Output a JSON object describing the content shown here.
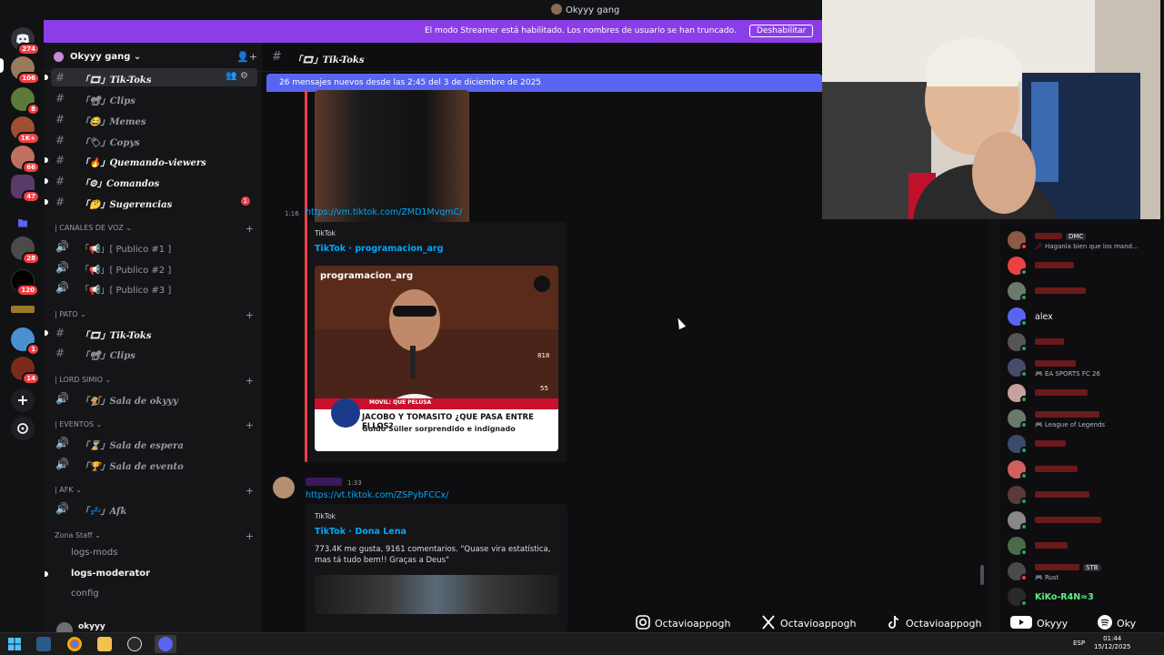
{
  "window": {
    "title": "Okyyy gang"
  },
  "banner": {
    "text": "El modo Streamer está habilitado. Los nombres de usuario se han truncado.",
    "button": "Deshabilitar"
  },
  "rail": {
    "badges": [
      "274",
      "106",
      "8",
      "1K+",
      "66",
      "47",
      "28",
      "120",
      "1",
      "14"
    ]
  },
  "guild": {
    "name": "Okyyy gang"
  },
  "channels": {
    "tiktoks": "「🎞」Tik-Toks",
    "clips": "「📽」Clips",
    "memes": "「😂」Memes",
    "copys": "「🏷」Copys",
    "quemando": "「🔥」Quemando-viewers",
    "comandos": "「⚙」Comandos",
    "sugerencias": "「🤔」Sugerencias",
    "sugerencias_badge": "1",
    "cat_voz": "| CANALES DE VOZ",
    "publico1": "「📢」[ Publico #1 ]",
    "publico2": "「📢」[ Publico #2 ]",
    "publico3": "「📢」[ Publico #3 ]",
    "cat_pato": "| PATO",
    "pato_tiktoks": "「🎞」Tik-Toks",
    "pato_clips": "「📽」Clips",
    "cat_lord": "| LORD SIMIO",
    "sala_okyyy": "「🐒」Sala de okyyy",
    "cat_eventos": "| EVENTOS",
    "sala_espera": "「⏳」Sala de espera",
    "sala_evento": "「🏆」Sala de evento",
    "cat_afk": "| AFK",
    "afk": "「💤」Afk",
    "cat_staff": "Zona Staff",
    "logs_mods": "logs-mods",
    "logs_moderator": "logs-moderator",
    "config": "config"
  },
  "user": {
    "name": "okyyy"
  },
  "chat": {
    "header": "「🎞」Tik-Toks",
    "newbar": "26 mensajes nuevos desde las 2:45 del 3 de diciembre de 2025",
    "msg1": {
      "time": "1:16",
      "link": "https://vm.tiktok.com/ZMD1MvqmC/",
      "provider": "TikTok",
      "title": "TikTok · programacion_arg",
      "overlay_user": "programacion_arg",
      "headline": "JACOBO Y TOMASITO ¿QUE PASA ENTRE ELLOS?",
      "subline": "Guido Süller sorprendido e indignado",
      "ticker": "MOVIL: QUE PELUSA",
      "likes": "818",
      "comments": "55",
      "shares": "218"
    },
    "msg2": {
      "time": "1:33",
      "link": "https://vt.tiktok.com/ZSPybFCCx/",
      "provider": "TikTok",
      "title": "TikTok · Dona Lena",
      "desc": "773.4K me gusta, 9161 comentarios. \"Quase vira estatística, mas tá tudo bem!! Graças a Deus\""
    }
  },
  "members": [
    {
      "name": "",
      "sub": "🥢 Haganla bien que los mand...",
      "tag": "DMC",
      "avatar": "#8a5a44",
      "status": "#f23f43"
    },
    {
      "name": "",
      "sub": "",
      "avatar": "#ed4245",
      "status": "#23a55a"
    },
    {
      "name": "",
      "sub": "",
      "avatar": "#6b7b6b",
      "status": "#23a55a"
    },
    {
      "name": "alex",
      "sub": "",
      "avatar": "#5865f2",
      "status": "#23a55a",
      "white": true
    },
    {
      "name": "",
      "sub": "",
      "avatar": "#555",
      "status": "#23a55a"
    },
    {
      "name": "",
      "sub": "🎮 EA SPORTS FC 26",
      "avatar": "#4a4a6a",
      "status": "#23a55a"
    },
    {
      "name": "",
      "sub": "",
      "avatar": "#c9a0a0",
      "status": "#23a55a"
    },
    {
      "name": "",
      "sub": "🎮 League of Legends",
      "avatar": "#6a7a6a",
      "status": "#23a55a"
    },
    {
      "name": "",
      "sub": "",
      "avatar": "#3a4a6a",
      "status": "#23a55a"
    },
    {
      "name": "",
      "sub": "",
      "avatar": "#d06060",
      "status": "#23a55a"
    },
    {
      "name": "",
      "sub": "",
      "avatar": "#5a3a3a",
      "status": "#23a55a"
    },
    {
      "name": "",
      "sub": "",
      "avatar": "#888",
      "status": "#23a55a"
    },
    {
      "name": "",
      "sub": "",
      "avatar": "#4a6a4a",
      "status": "#23a55a"
    },
    {
      "name": "",
      "sub": "🎮 Rust",
      "tag": "STB",
      "avatar": "#4a4a4a",
      "status": "#f23f43"
    },
    {
      "name": "KiKo-R4N≈3",
      "sub": "",
      "avatar": "#2a2a2a",
      "status": "#23a55a",
      "green": true
    }
  ],
  "social": {
    "instagram": "Octavioappogh",
    "x": "Octavioappogh",
    "tiktok": "Octavioappogh",
    "youtube": "Okyyy",
    "spotify": "Oky"
  },
  "taskbar": {
    "lang": "ESP",
    "time": "01:44",
    "date": "15/12/2025"
  }
}
